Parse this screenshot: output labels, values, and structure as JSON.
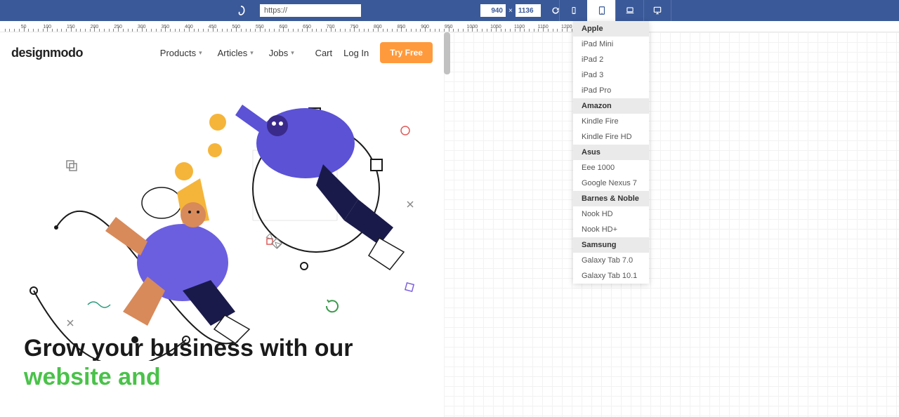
{
  "toolbar": {
    "url_value": "https://",
    "width_value": "940",
    "height_value": "1136"
  },
  "ruler": {
    "major_step": 50,
    "max": 1300
  },
  "site": {
    "brand": "designmodo",
    "nav": [
      "Products",
      "Articles",
      "Jobs"
    ],
    "cart": "Cart",
    "login": "Log In",
    "try": "Try Free",
    "hero_text_1": "Grow your business with our ",
    "hero_text_2": "website and"
  },
  "dropdown": {
    "groups": [
      {
        "name": "Apple",
        "items": [
          "iPad Mini",
          "iPad 2",
          "iPad 3",
          "iPad Pro"
        ]
      },
      {
        "name": "Amazon",
        "items": [
          "Kindle Fire",
          "Kindle Fire HD"
        ]
      },
      {
        "name": "Asus",
        "items": [
          "Eee 1000",
          "Google Nexus 7"
        ]
      },
      {
        "name": "Barnes & Noble",
        "items": [
          "Nook HD",
          "Nook HD+"
        ]
      },
      {
        "name": "Samsung",
        "items": [
          "Galaxy Tab 7.0",
          "Galaxy Tab 10.1"
        ]
      }
    ]
  }
}
